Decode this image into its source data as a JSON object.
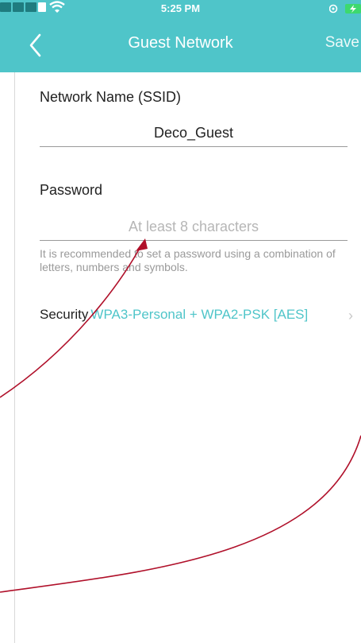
{
  "status_bar": {
    "time": "5:25 PM"
  },
  "nav": {
    "title": "Guest Network",
    "save_label": "Save"
  },
  "ssid": {
    "label": "Network Name (SSID)",
    "value": "Deco_Guest"
  },
  "password": {
    "label": "Password",
    "value": "",
    "placeholder": "At least 8 characters",
    "hint": "It is recommended to set a password using a combination of letters, numbers and symbols."
  },
  "security": {
    "label": "Security",
    "value": "WPA3-Personal + WPA2-PSK [AES]"
  },
  "icons": [
    "wifi-icon",
    "back-chevron-icon",
    "chevron-right-icon",
    "battery-icon"
  ],
  "colors": {
    "accent": "#4fc5c9",
    "annotation": "#b0102a",
    "status_signal": "#1f7c7f"
  }
}
